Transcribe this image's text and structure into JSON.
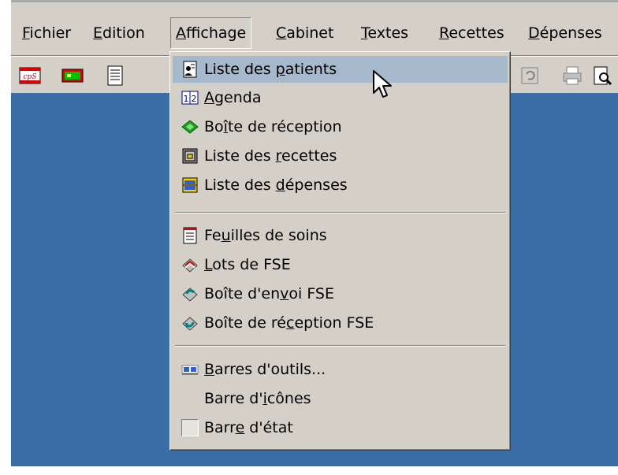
{
  "menubar": {
    "items": [
      {
        "pre": "",
        "key": "F",
        "post": "ichier"
      },
      {
        "pre": "",
        "key": "E",
        "post": "dition"
      },
      {
        "pre": "",
        "key": "A",
        "post": "ffichage"
      },
      {
        "pre": "",
        "key": "C",
        "post": "abinet"
      },
      {
        "pre": "",
        "key": "T",
        "post": "extes"
      },
      {
        "pre": "",
        "key": "R",
        "post": "ecettes"
      },
      {
        "pre": "",
        "key": "D",
        "post": "épenses"
      }
    ]
  },
  "toolbar": {
    "buttons": [
      "cps-card-icon",
      "green-card-icon",
      "document-icon",
      "refresh-icon",
      "print-icon",
      "print-preview-icon"
    ]
  },
  "affichage_menu": {
    "items": [
      {
        "pre": "Liste des ",
        "key": "p",
        "post": "atients",
        "icon": "patients-list-icon"
      },
      {
        "pre": "",
        "key": "A",
        "post": "genda",
        "icon": "agenda-icon"
      },
      {
        "pre": "Bo",
        "key": "î",
        "post": "te de réception",
        "icon": "inbox-icon"
      },
      {
        "pre": "Liste des ",
        "key": "r",
        "post": "ecettes",
        "icon": "receipts-icon"
      },
      {
        "pre": "Liste des ",
        "key": "d",
        "post": "épenses",
        "icon": "expenses-icon"
      },
      {
        "pre": "Fe",
        "key": "u",
        "post": "illes de soins",
        "icon": "care-sheets-icon"
      },
      {
        "pre": "",
        "key": "L",
        "post": "ots de FSE",
        "icon": "fse-batches-icon"
      },
      {
        "pre": "Boîte d'en",
        "key": "v",
        "post": "oi FSE",
        "icon": "fse-outbox-icon"
      },
      {
        "pre": "Boîte de ré",
        "key": "c",
        "post": "eption FSE",
        "icon": "fse-inbox-icon"
      },
      {
        "pre": "",
        "key": "B",
        "post": "arres d'outils...",
        "icon": "toolbars-icon"
      },
      {
        "pre": "Barre d'",
        "key": "i",
        "post": "cônes",
        "icon": ""
      },
      {
        "pre": "Barr",
        "key": "e",
        "post": " d'état",
        "icon": "status-bar-check"
      }
    ]
  },
  "colors": {
    "workspace": "#3a6ea5",
    "face": "#d4d0c8",
    "highlight": "#a6b8cb"
  }
}
